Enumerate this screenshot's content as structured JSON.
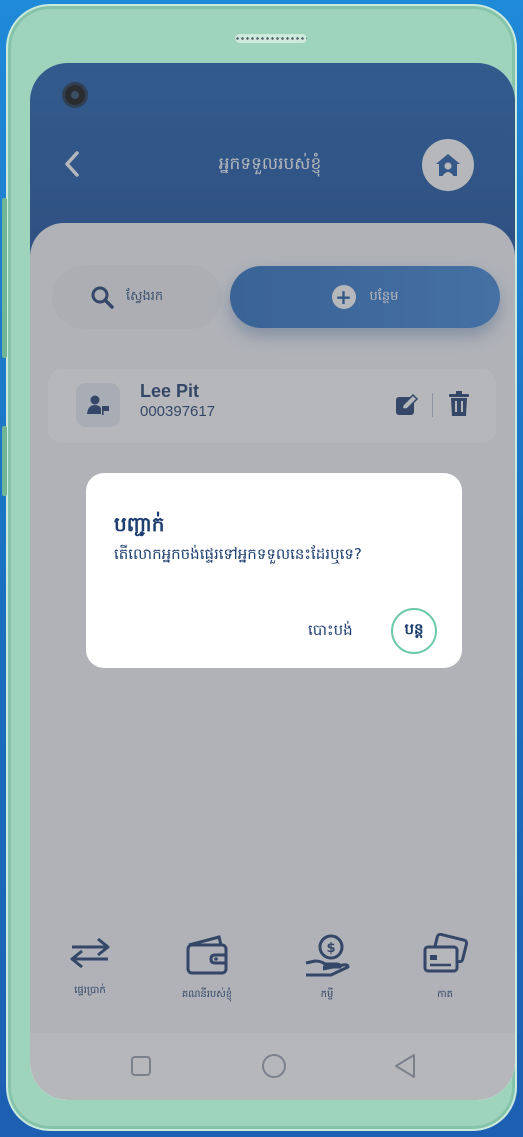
{
  "header": {
    "title": "អ្នកទទួលរបស់ខ្ញុំ"
  },
  "toolbar": {
    "search_label": "ស្វែងរក",
    "add_label": "បន្ថែម"
  },
  "recipient": {
    "name": "Lee Pit",
    "account": "000397617"
  },
  "nav": {
    "items": [
      {
        "label": "ផ្ទេរប្រាក់",
        "icon": "transfer-icon"
      },
      {
        "label": "គណនីរបស់ខ្ញុំ",
        "icon": "wallet-icon"
      },
      {
        "label": "កម្ចី",
        "icon": "loan-icon"
      },
      {
        "label": "កាត",
        "icon": "card-icon"
      }
    ]
  },
  "dialog": {
    "title": "បញ្ជាក់",
    "message": "តើលោកអ្នកចង់ផ្ទេរទៅអ្នកទទួលនេះដែរឬទេ?",
    "cancel_label": "បោះបង់",
    "confirm_label": "បន្ត"
  },
  "colors": {
    "primary": "#1f5ea8",
    "text": "#1f3f70",
    "accent": "#6cc9a8"
  }
}
